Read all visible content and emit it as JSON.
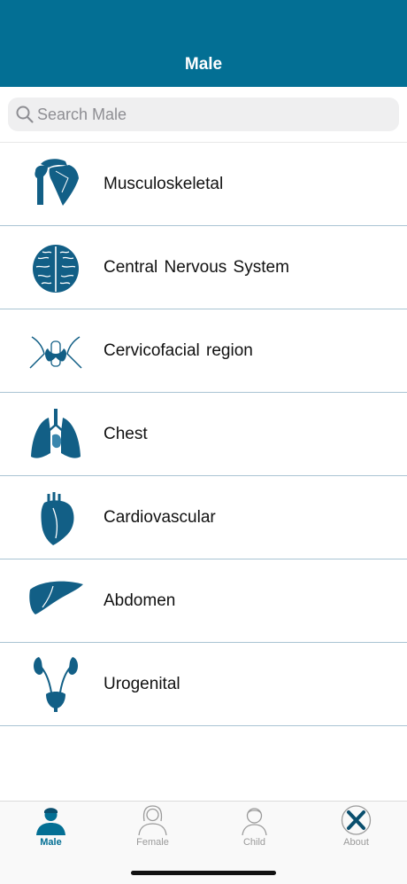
{
  "header": {
    "title": "Male"
  },
  "search": {
    "placeholder": "Search Male",
    "value": ""
  },
  "categories": [
    {
      "label": "Musculoskeletal",
      "icon": "shoulder-bone-icon"
    },
    {
      "label": "Central Nervous System",
      "icon": "brain-icon"
    },
    {
      "label": "Cervicofacial region",
      "icon": "thyroid-icon"
    },
    {
      "label": "Chest",
      "icon": "lungs-icon"
    },
    {
      "label": "Cardiovascular",
      "icon": "heart-icon"
    },
    {
      "label": "Abdomen",
      "icon": "liver-icon"
    },
    {
      "label": "Urogenital",
      "icon": "kidneys-icon"
    }
  ],
  "tabs": [
    {
      "label": "Male",
      "icon": "male-person-icon",
      "active": true
    },
    {
      "label": "Female",
      "icon": "female-person-icon",
      "active": false
    },
    {
      "label": "Child",
      "icon": "child-person-icon",
      "active": false
    },
    {
      "label": "About",
      "icon": "app-logo-icon",
      "active": false
    }
  ],
  "colors": {
    "brand": "#036f94",
    "icon": "#125f86",
    "inactive": "#9a9a9a",
    "divider": "#a9c4d3"
  }
}
